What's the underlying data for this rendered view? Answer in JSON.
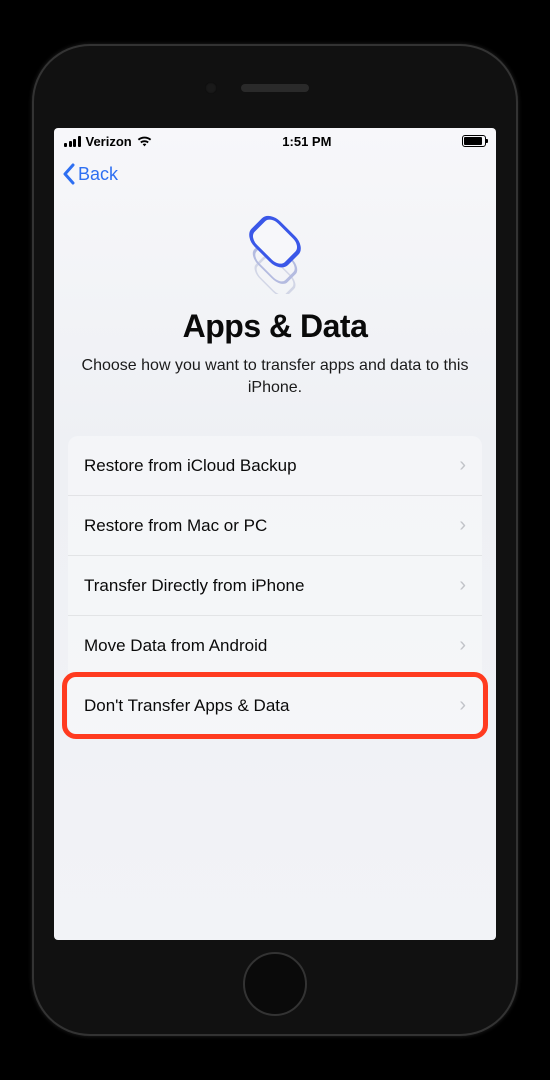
{
  "status_bar": {
    "carrier": "Verizon",
    "time": "1:51 PM"
  },
  "nav": {
    "back_label": "Back"
  },
  "header": {
    "title": "Apps & Data",
    "subtitle": "Choose how you want to transfer apps and data to this iPhone."
  },
  "options": [
    {
      "label": "Restore from iCloud Backup",
      "highlighted": false
    },
    {
      "label": "Restore from Mac or PC",
      "highlighted": false
    },
    {
      "label": "Transfer Directly from iPhone",
      "highlighted": false
    },
    {
      "label": "Move Data from Android",
      "highlighted": false
    },
    {
      "label": "Don't Transfer Apps & Data",
      "highlighted": true
    }
  ],
  "colors": {
    "accent": "#2e6ff2",
    "highlight_border": "#ff3b20"
  }
}
